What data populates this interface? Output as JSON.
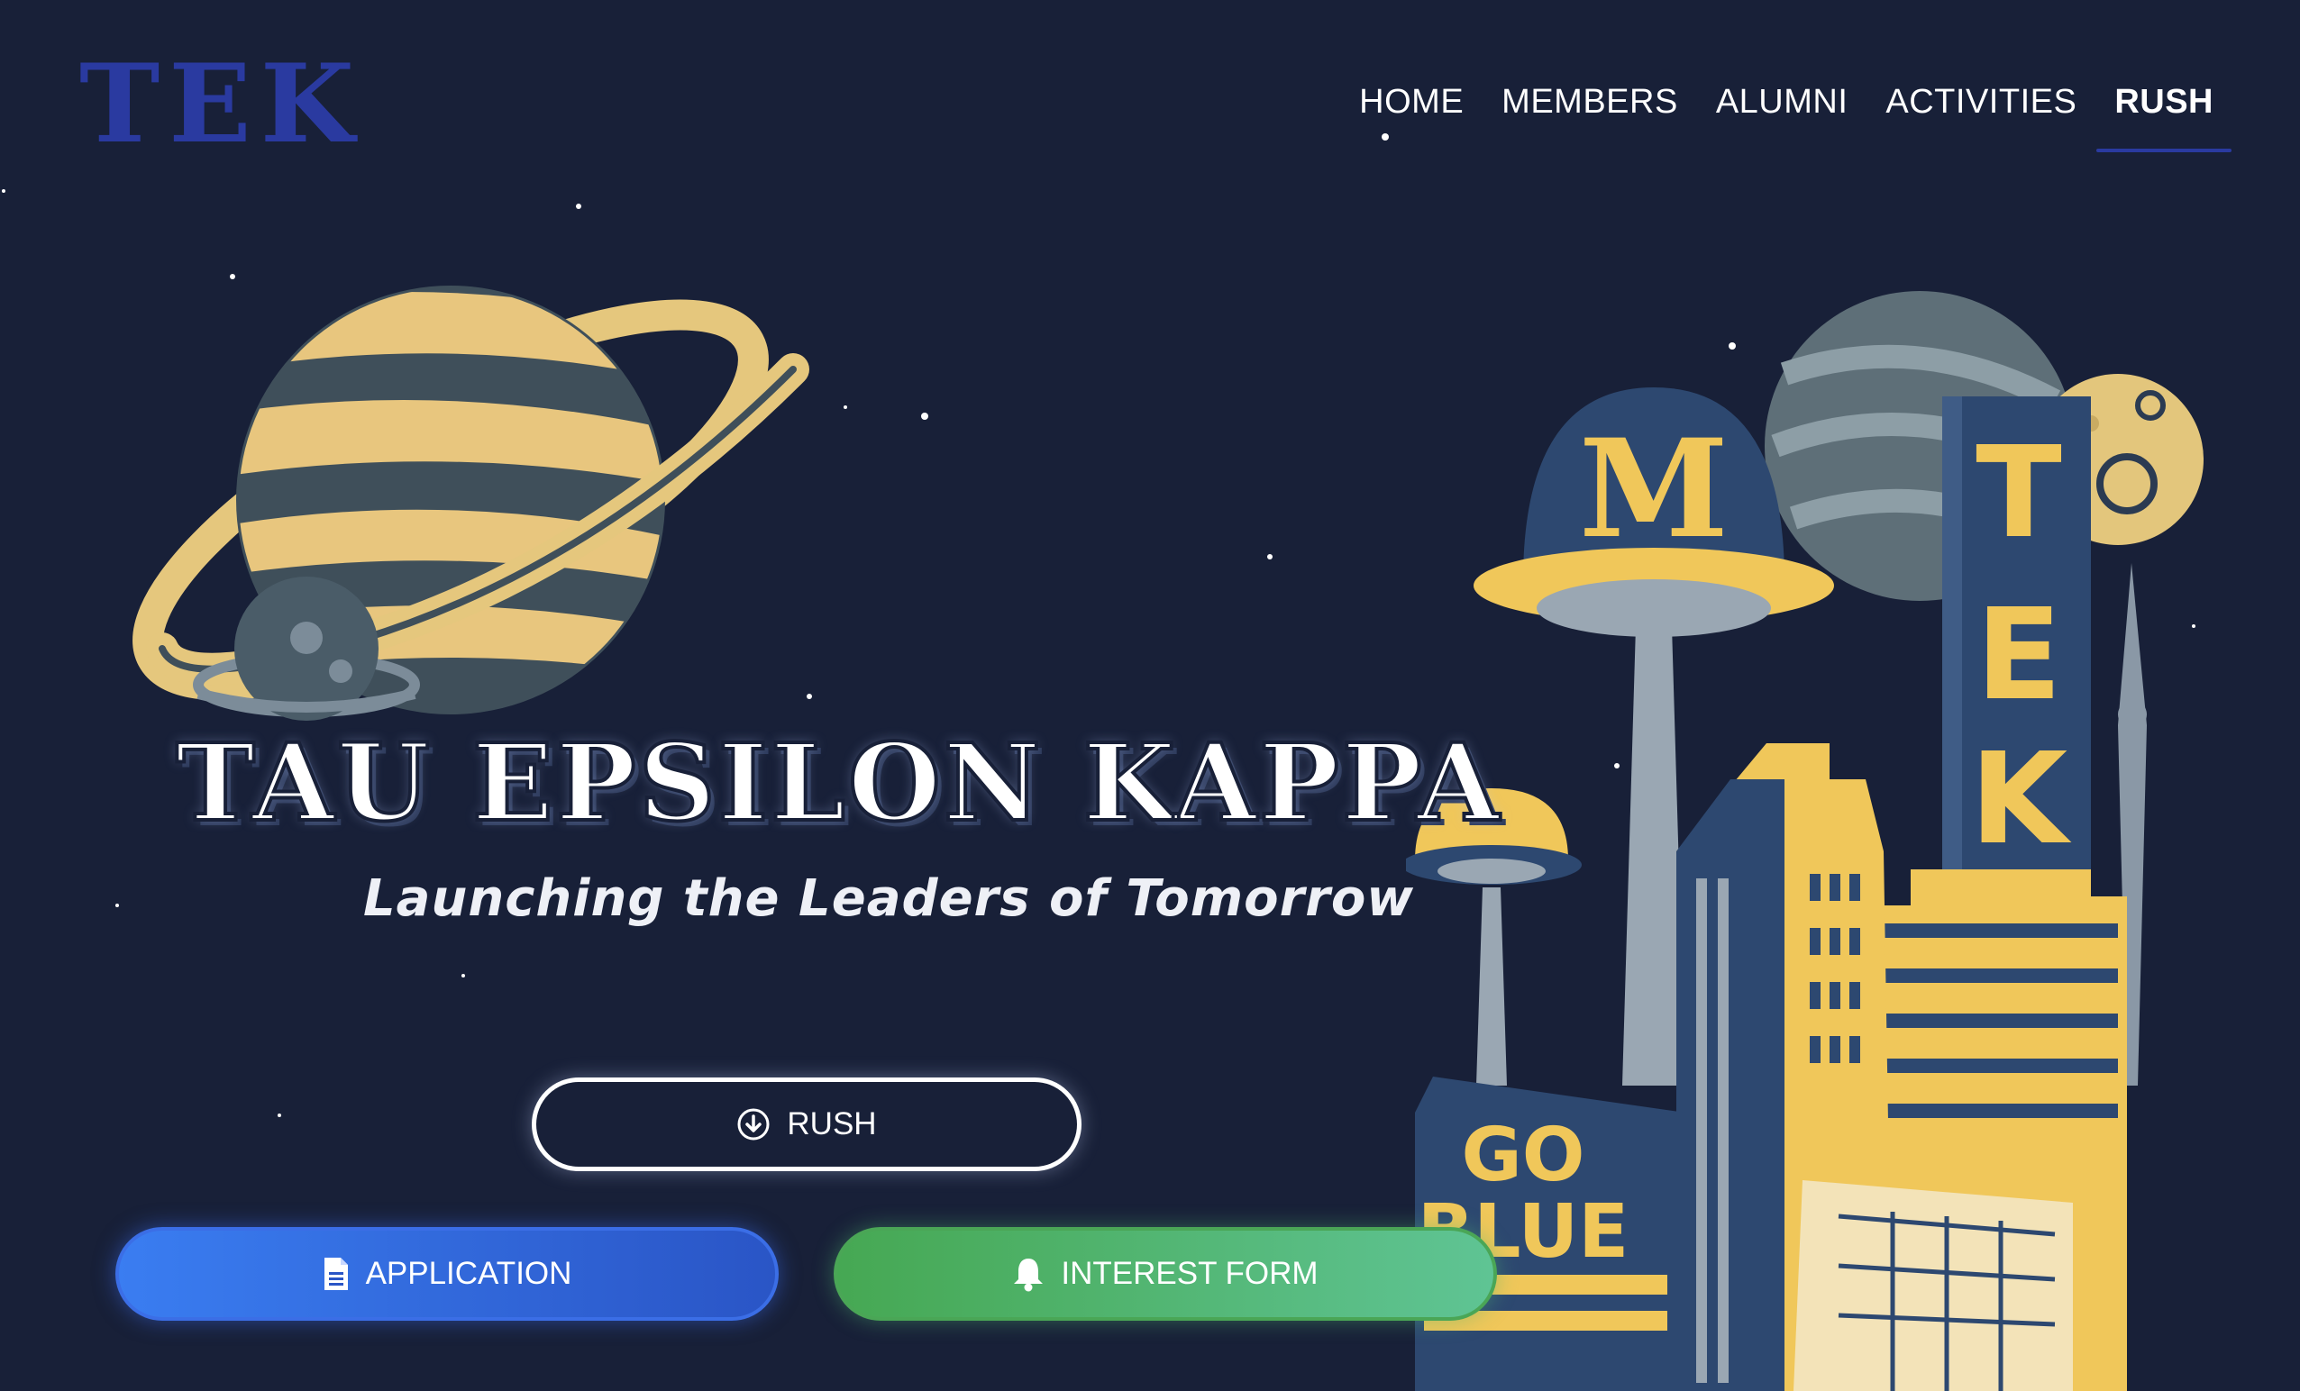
{
  "logo": {
    "text": "TEK"
  },
  "nav": {
    "items": [
      {
        "label": "HOME"
      },
      {
        "label": "MEMBERS"
      },
      {
        "label": "ALUMNI"
      },
      {
        "label": "ACTIVITIES"
      },
      {
        "label": "RUSH",
        "active": true
      }
    ]
  },
  "hero": {
    "title": "TAU EPSILON KAPPA",
    "tagline": "Launching the Leaders of Tomorrow"
  },
  "buttons": {
    "rush": {
      "label": "RUSH",
      "icon": "download-circle-icon"
    },
    "application": {
      "label": "APPLICATION",
      "icon": "document-icon"
    },
    "interest": {
      "label": "INTEREST FORM",
      "icon": "bell-icon"
    }
  },
  "city": {
    "dome_letter": "M",
    "tower_letters": [
      "T",
      "E",
      "K"
    ],
    "sign_line1": "GO",
    "sign_line2": "BLUE"
  },
  "colors": {
    "background": "#182038",
    "navy": "#2a3aa0",
    "maize": "#f0c75a",
    "blue_button": "#3a7df1",
    "green_button": "#46a853"
  }
}
